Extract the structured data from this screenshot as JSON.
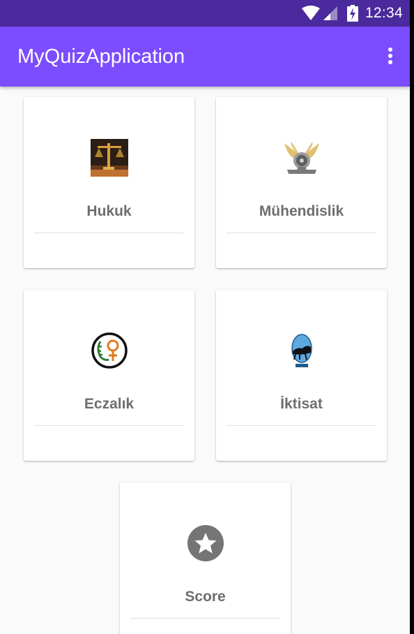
{
  "status_bar": {
    "time": "12:34"
  },
  "app_bar": {
    "title": "MyQuizApplication"
  },
  "categories": [
    {
      "label": "Hukuk",
      "icon": "scales-of-justice-icon"
    },
    {
      "label": "Mühendislik",
      "icon": "engineering-gear-icon"
    },
    {
      "label": "Eczalık",
      "icon": "pharmacy-caduceus-icon"
    },
    {
      "label": "İktisat",
      "icon": "economics-emblem-icon"
    },
    {
      "label": "Score",
      "icon": "star-icon"
    }
  ]
}
